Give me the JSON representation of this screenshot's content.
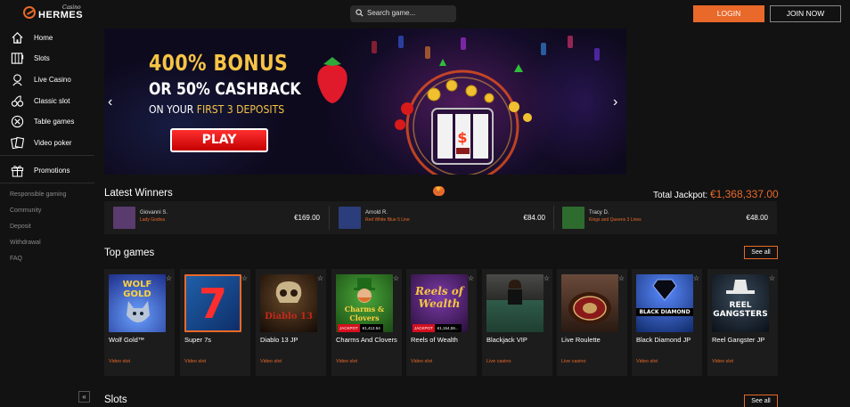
{
  "brand": {
    "top": "Casino",
    "name": "HERMES"
  },
  "search": {
    "placeholder": "Search game..."
  },
  "auth": {
    "login": "LOGIN",
    "join": "JOIN NOW"
  },
  "sidebar": {
    "items": [
      {
        "label": "Home",
        "icon": "home-icon"
      },
      {
        "label": "Slots",
        "icon": "slots-icon"
      },
      {
        "label": "Live Casino",
        "icon": "live-casino-icon"
      },
      {
        "label": "Classic slot",
        "icon": "cherry-icon"
      },
      {
        "label": "Table games",
        "icon": "chip-icon"
      },
      {
        "label": "Video poker",
        "icon": "cards-icon"
      }
    ],
    "promotions": {
      "label": "Promotions",
      "icon": "gift-icon"
    },
    "links": [
      "Responsible gaming",
      "Community",
      "Deposit",
      "Withdrawal",
      "FAQ"
    ],
    "collapse": "«"
  },
  "banner": {
    "line1": "400% BONUS",
    "line2": "OR 50% CASHBACK",
    "line3_a": "ON YOUR ",
    "line3_b": "FIRST 3 DEPOSITS",
    "play": "PLAY",
    "prev": "‹",
    "next": "›"
  },
  "winners": {
    "title": "Latest Winners",
    "total_label": "Total Jackpot:",
    "total_amount": "€1,368,337.00",
    "list": [
      {
        "name": "Giovanni S.",
        "game": "Lady Godiva",
        "amount": "€169.00",
        "color": "#5a3b6e"
      },
      {
        "name": "Arnold R.",
        "game": "Red White Blue 5 Line",
        "amount": "€84.00",
        "color": "#2b3d7a"
      },
      {
        "name": "Tracy D.",
        "game": "Kings and Queens 3 Lines",
        "amount": "€48.00",
        "color": "#2e6b2e"
      }
    ]
  },
  "top_games": {
    "title": "Top games",
    "see_all": "See all",
    "games": [
      {
        "title": "Wolf Gold™",
        "category": "Video slot",
        "art": "WOLF GOLD",
        "bg": "#2a3f9b",
        "fg": "#ffd23f"
      },
      {
        "title": "Super 7s",
        "category": "Video slot",
        "art": "7",
        "bg": "#1f5fa8",
        "fg": "#ff2d2d"
      },
      {
        "title": "Diablo 13 JP",
        "category": "Video slot",
        "art": "Diablo 13",
        "bg": "#2a1a10",
        "fg": "#c4281c"
      },
      {
        "title": "Charms And Clovers",
        "category": "Video slot",
        "art": "Charms & Clovers",
        "bg": "#2d6a22",
        "fg": "#ffd23f",
        "jackpot": "JACKPOT",
        "jackpot_value": "€1,412.54"
      },
      {
        "title": "Reels of Wealth",
        "category": "Video slot",
        "art": "Reels of Wealth",
        "bg": "#4a1f6a",
        "fg": "#f6c445",
        "jackpot": "JACKPOT",
        "jackpot_value": "€1,154,59..."
      },
      {
        "title": "Blackjack VIP",
        "category": "Live casino",
        "art": "",
        "bg": "#3a4a44",
        "fg": "#ffffff"
      },
      {
        "title": "Live Roulette",
        "category": "Live casino",
        "art": "",
        "bg": "#5a3a2a",
        "fg": "#ffffff"
      },
      {
        "title": "Black Diamond JP",
        "category": "Video slot",
        "art": "BLACK DIAMOND",
        "bg": "#1c3f8a",
        "fg": "#ffffff"
      },
      {
        "title": "Reel Gangster JP",
        "category": "Video slot",
        "art": "REEL GANGSTERS",
        "bg": "#1a2a3a",
        "fg": "#ffffff"
      }
    ]
  },
  "slots": {
    "title": "Slots",
    "see_all": "See all"
  }
}
